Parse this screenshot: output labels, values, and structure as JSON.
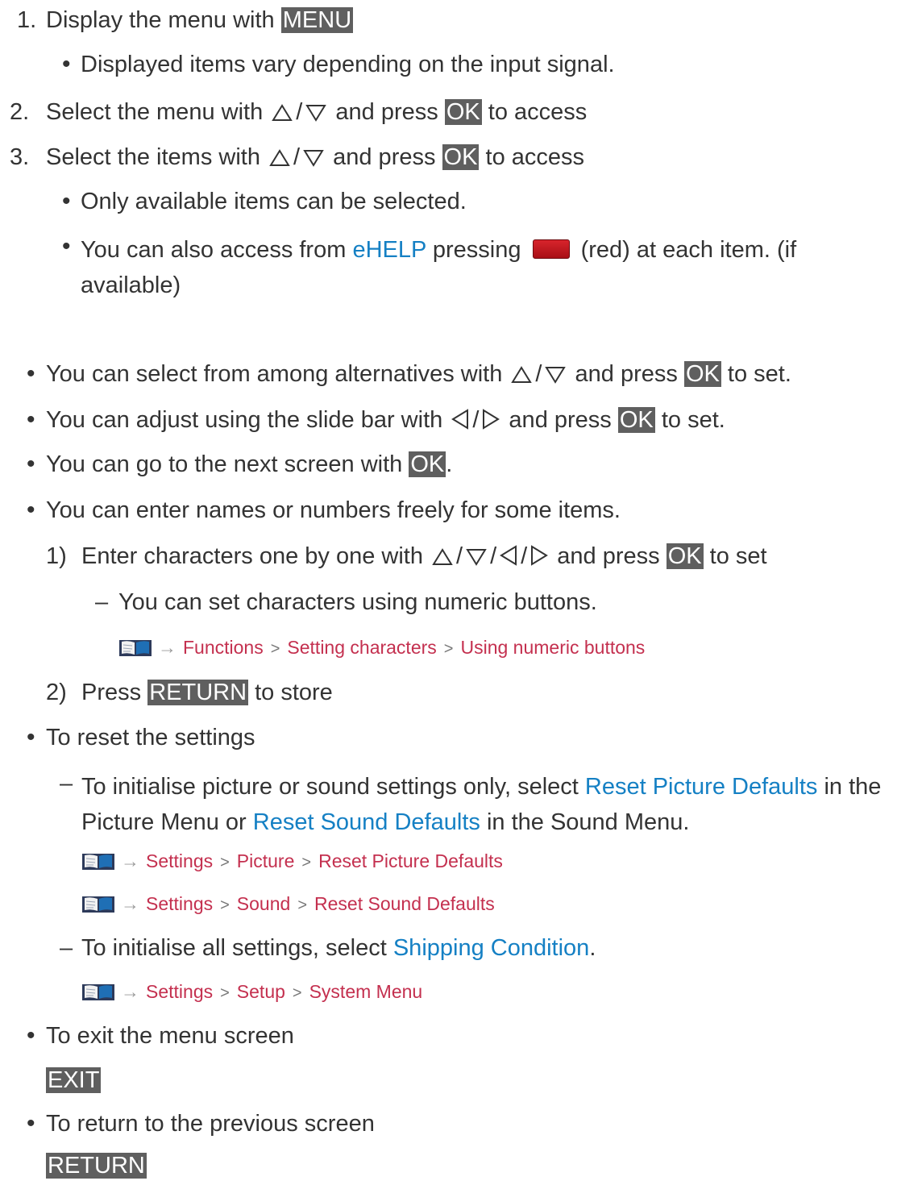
{
  "steps": [
    {
      "num": "1.",
      "pre": "Display the menu with ",
      "key": "MENU"
    },
    {
      "note": "Displayed items vary depending on the input signal."
    },
    {
      "num": "2.",
      "pre": "Select the menu with ",
      "slash": "/",
      "mid": " and press ",
      "key": "OK",
      "post": " to access"
    },
    {
      "num": "3.",
      "pre": "Select the items with ",
      "slash": "/",
      "mid": " and press ",
      "key": "OK",
      "post": " to access"
    },
    {
      "note": "Only available items can be selected."
    },
    {
      "note_pre": "You can also access from ",
      "link": "eHELP",
      "note_mid": " pressing ",
      "note_post": " (red) at each item. (if available)"
    }
  ],
  "tips": {
    "alternatives": {
      "pre": "You can select from among alternatives with ",
      "slash": "/",
      "mid": " and press ",
      "key": "OK",
      "post": " to set."
    },
    "slide": {
      "pre": "You can adjust using the slide bar with ",
      "slash": "/",
      "mid": " and press ",
      "key": "OK",
      "post": " to set."
    },
    "next": {
      "pre": "You can go to the next screen with ",
      "key": "OK",
      "post": "."
    },
    "names": {
      "text": "You can enter names or numbers freely for some items."
    },
    "enter": {
      "num": "1)",
      "pre": "Enter characters one by one with ",
      "slash": "/",
      "mid": " and press ",
      "key": "OK",
      "post": " to set"
    },
    "numeric": {
      "dash": "–",
      "text": "You can set characters using numeric buttons."
    },
    "ref_numeric": {
      "arrow": "→",
      "sep": ">",
      "path": [
        "Functions",
        "Setting characters",
        "Using numeric buttons"
      ]
    },
    "store": {
      "num": "2)",
      "pre": "Press ",
      "key": "RETURN",
      "post": " to store"
    },
    "reset": {
      "text": "To reset the settings"
    },
    "reset_detail": {
      "dash": "–",
      "pre": "To initialise picture or sound settings only, select ",
      "link1": "Reset Picture Defaults",
      "mid": " in the Picture Menu or ",
      "link2": "Reset Sound Defaults",
      "post": " in the Sound Menu."
    },
    "ref_picture": {
      "arrow": "→",
      "sep": ">",
      "path": [
        "Settings",
        "Picture",
        "Reset Picture Defaults"
      ]
    },
    "ref_sound": {
      "arrow": "→",
      "sep": ">",
      "path": [
        "Settings",
        "Sound",
        "Reset Sound Defaults"
      ]
    },
    "reset_all": {
      "dash": "–",
      "pre": "To initialise all settings, select ",
      "link": "Shipping Condition",
      "post": "."
    },
    "ref_system": {
      "arrow": "→",
      "sep": ">",
      "path": [
        "Settings",
        "Setup",
        "System Menu"
      ]
    },
    "exit": {
      "text": "To exit the menu screen",
      "key": "EXIT"
    },
    "return": {
      "text": "To return to the previous screen",
      "key": "RETURN"
    }
  },
  "bullet": "•",
  "colors": {
    "text": "#333333",
    "link": "#1580c4",
    "reference": "#c4304f",
    "key_bg": "#5f5f5f",
    "red_button": "#c8161d"
  }
}
